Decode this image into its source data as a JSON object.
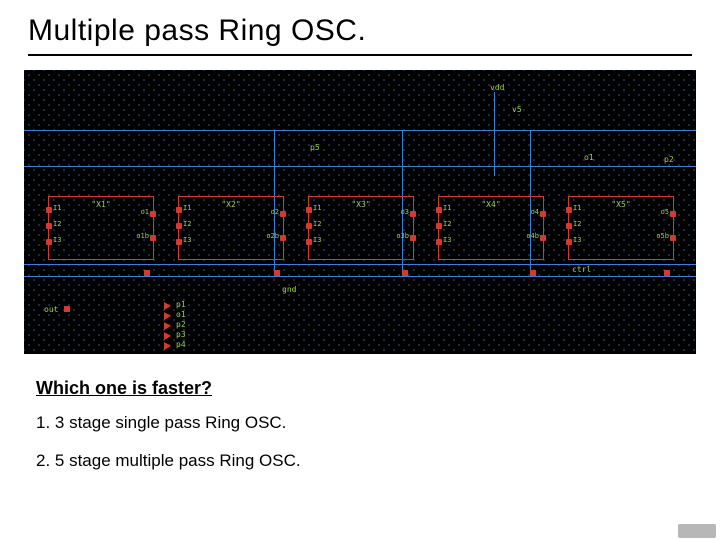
{
  "title": "Multiple pass Ring OSC.",
  "schematic": {
    "rails": {
      "vdd": "vdd",
      "mid": "",
      "gnd": "gnd"
    },
    "netlabels": {
      "top_v5": "v5",
      "feed_p5": "p5",
      "ctrl": "ctrl",
      "p2": "p2",
      "o1": "o1",
      "out_port": "out"
    },
    "stages": [
      {
        "name": "\"X1\"",
        "ins": [
          "I1",
          "I2",
          "I3"
        ],
        "outs": [
          "o1",
          "o1b"
        ]
      },
      {
        "name": "\"X2\"",
        "ins": [
          "I1",
          "I2",
          "I3"
        ],
        "outs": [
          "o2",
          "o2b"
        ]
      },
      {
        "name": "\"X3\"",
        "ins": [
          "I1",
          "I2",
          "I3"
        ],
        "outs": [
          "o3",
          "o3b"
        ]
      },
      {
        "name": "\"X4\"",
        "ins": [
          "I1",
          "I2",
          "I3"
        ],
        "outs": [
          "o4",
          "o4b"
        ]
      },
      {
        "name": "\"X5\"",
        "ins": [
          "I1",
          "I2",
          "I3"
        ],
        "outs": [
          "o5",
          "o5b"
        ]
      }
    ],
    "ports": [
      "p1",
      "o1",
      "p2",
      "p3",
      "p4"
    ]
  },
  "question": "Which one is faster?",
  "options": [
    "1.  3 stage single pass Ring OSC.",
    "2.  5 stage multiple pass Ring OSC."
  ]
}
